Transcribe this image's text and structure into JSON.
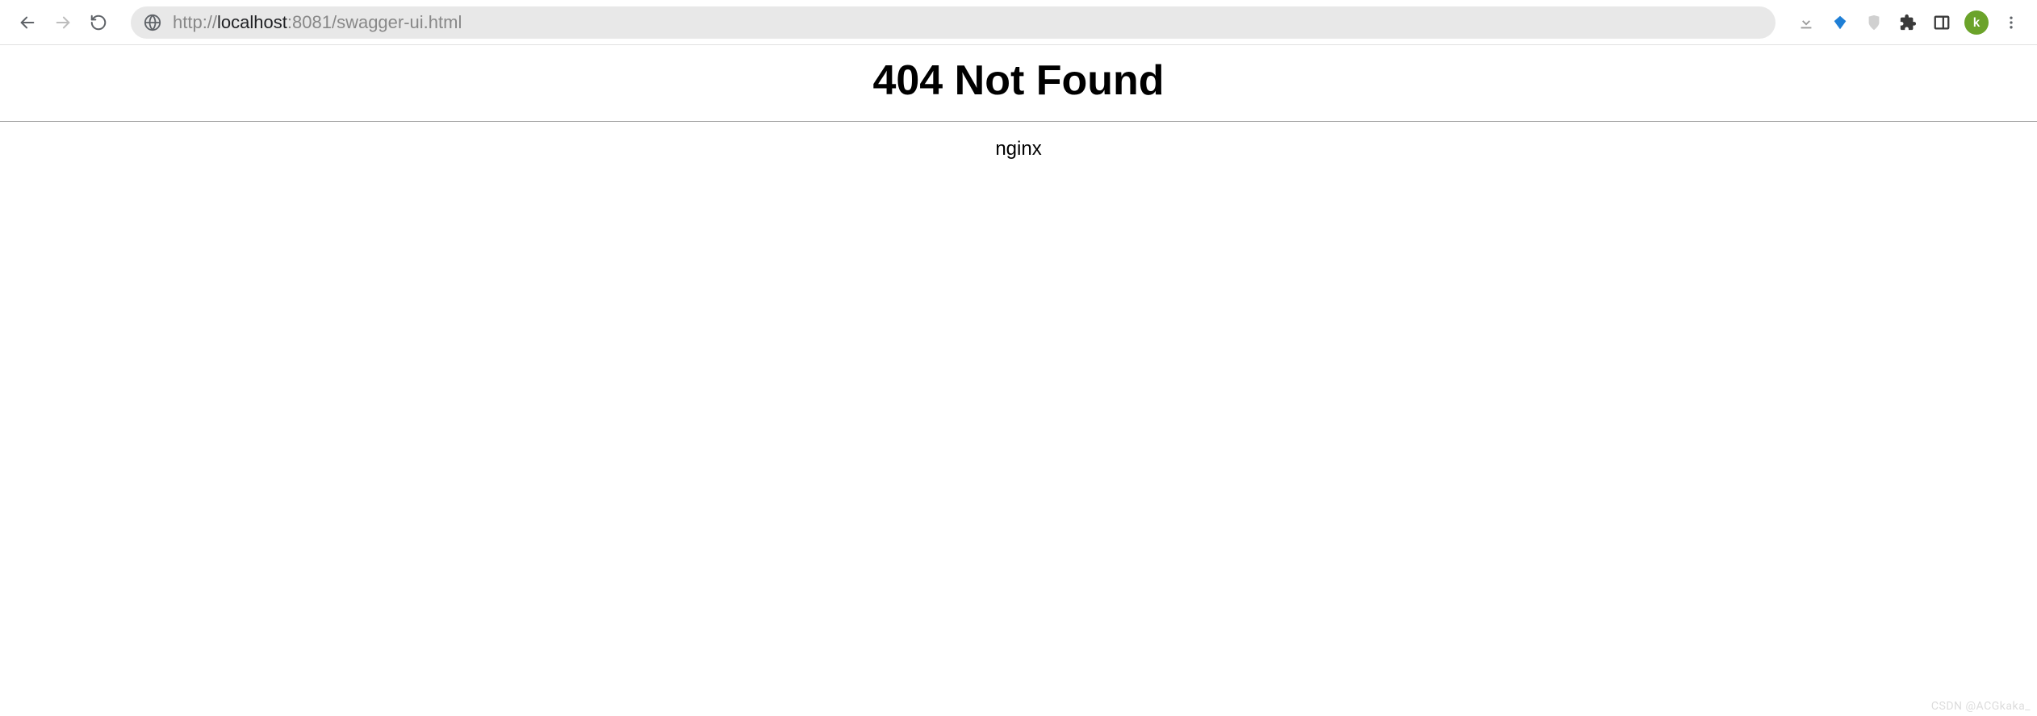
{
  "browser": {
    "url": {
      "scheme": "http://",
      "host": "localhost",
      "port": ":8081",
      "path": "/swagger-ui.html"
    },
    "avatar_initial": "k"
  },
  "page": {
    "title": "404 Not Found",
    "server": "nginx"
  },
  "watermark": "CSDN @ACGkaka_"
}
